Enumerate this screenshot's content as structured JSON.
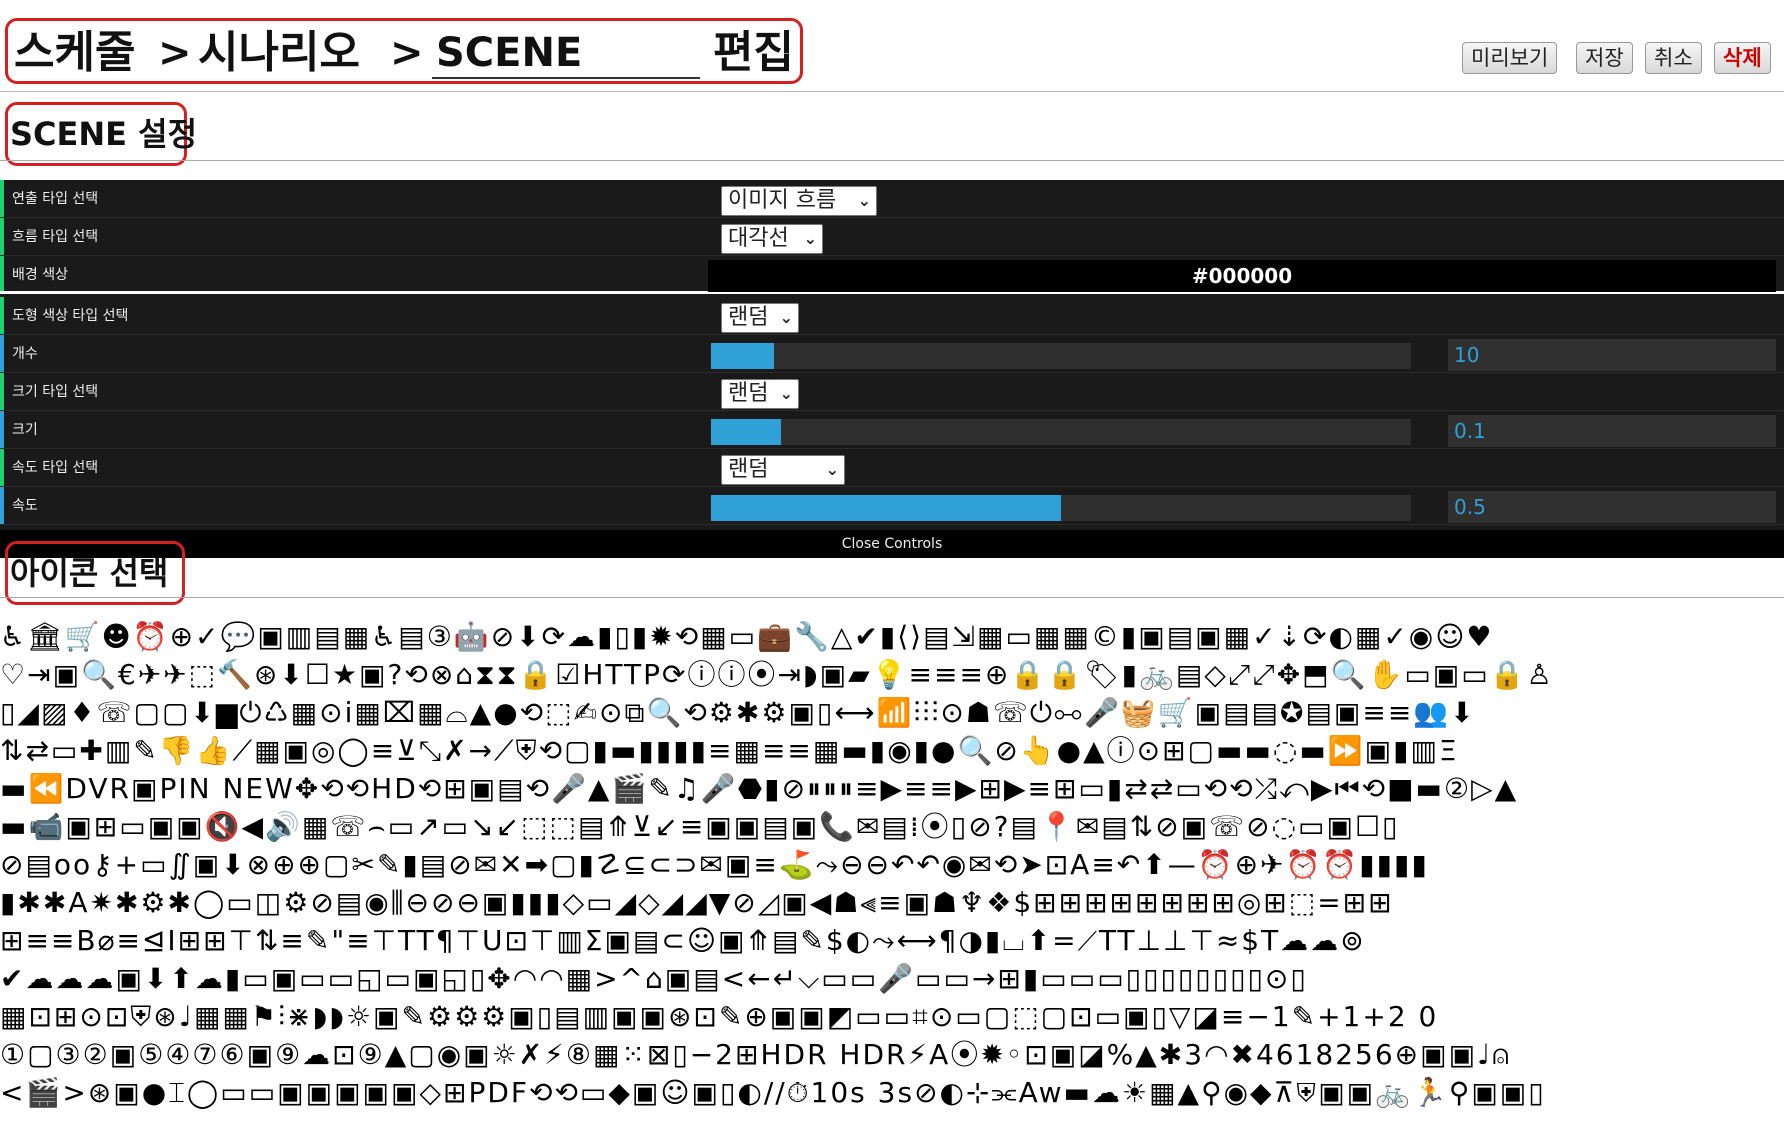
{
  "header": {
    "breadcrumb": [
      "스케줄",
      "시나리오"
    ],
    "separator": ">",
    "scene_input_value": "SCENE",
    "edit_label": "편집",
    "buttons": {
      "preview": "미리보기",
      "save": "저장",
      "cancel": "취소",
      "delete": "삭제"
    }
  },
  "scene_settings": {
    "title": "SCENE 설정",
    "rows": [
      {
        "label": "연출 타입 선택",
        "type": "select",
        "value": "이미지 흐름",
        "accent": "#1ed36f"
      },
      {
        "label": "흐름 타입 선택",
        "type": "select",
        "value": "대각선",
        "accent": "#1ed36f"
      },
      {
        "label": "배경 색상",
        "type": "color",
        "value": "#000000",
        "accent": "#1ed36f"
      },
      {
        "label": "도형 색상 타입 선택",
        "type": "select",
        "value": "랜덤",
        "accent": "#1ed36f"
      },
      {
        "label": "개수",
        "type": "slider",
        "value": "10",
        "fill": 0.09,
        "accent": "#2fa1d6"
      },
      {
        "label": "크기 타입 선택",
        "type": "select",
        "value": "랜덤",
        "accent": "#1ed36f"
      },
      {
        "label": "크기",
        "type": "slider",
        "value": "0.1",
        "fill": 0.1,
        "accent": "#2fa1d6"
      },
      {
        "label": "속도 타입 선택",
        "type": "select",
        "value": "랜덤",
        "accent": "#1ed36f"
      },
      {
        "label": "속도",
        "type": "slider",
        "value": "0.5",
        "fill": 0.5,
        "accent": "#2fa1d6"
      }
    ],
    "close_label": "Close Controls"
  },
  "icon_select": {
    "title": "아이콘 선택",
    "rows": [
      "♿🏛🛒☻⏰⊕✓💬▣▥▤▦♿▤③🤖⊘⬇⟳☁▮▯▮✹⟲▦▭💼🔧△✔▮⟨⟩▤⇲▦▭▦▦©▮▣▤▣▦✓⇣⟳◐▦✓◉☺♥",
      "♡⇥▣🔍€✈✈⬚🔨⊛⬇☐★▣?⟲⊗⌂⧗⧗🔒☑HTTP⟳ⓘⓘ⦿⇥◗▣▰💡≡≡≡⊕🔒🔒🏷▮🚲▤◇⤢⤢✥⬒🔍✋▭▣▭🔒♙",
      "▯◢▨♦☏▢▢⬇▆⏻♺▦⊙ⅰ▦⌧▦⌓▲●⟲⬚✍⊙⧉🔍⟲⚙✱⚙▣▯⟷📶⫶⫶⫶⊙☗☏⏻⧟🎤🧺🛒▣▤▤✪▤▣≡≡👥⬇",
      "⇅⇄▭✚▥✎👎👍⟋▦▣◎◯≡⊻⤡✗→⟋⛨⟲▢▮▬▮▮▮▮≡▦≡≡▦▬▮◉▮●🔍⊘👆●▲ⓘ⊙⊞▢▬▬◌▬⏩▣▮▥Ξ",
      "▬⏪DVR▣PIN NEW✥⟲⟲HD⟲⊞▣▤⟲🎤▲🎬✎♫🎤⬣▮⊘⏸⏸⏸≡▶≡≡▶⊞▶≡⊞▭▮⇄⇄▭⟲⟲⤮⤺▶⏮⟲■▬②▷▲",
      "▬📹▣⊞▭▣▣🔇◀🔊▦☏⌢▭↗▭↘↙⬚⬚▤⤊⊻↙≡▣▣▤▣📞✉▤⁞⦿▯⊘?▤📍✉▤⇅⊘▣☏⊘◌▭▣☐▯",
      "⊘▤oo⚷+▭∬▣⬇⊗⊕⊕▢✂✎▮▤⊘✉✕➡▢▮☡⊆⊂⊃✉▣≡⛳⤳⊖⊖↶↶◉✉⟲➤⊡A≡↶⬆—⏰⊕✈⏰⏰▮▮▮▮",
      "▮✱✱A✷✱⚙✱◯▭◫⚙⊘▤◉⫼⊖⊘⊖▣▮▮▮◇▭◢◇◢◢▼⊘◿▣◀☗⫷≡▣☗♆❖$⊞⊞⊞⊞⊞⊞⊞⊞◎⊞⬚=⊞⊞",
      "⊞≡≡B⌀≡⊴I⊞⊞⊤⇅≡✎\"≡⊤TT¶⊤U⊡⊤▥Σ▣▤⊂☺▣⤊▤✎$◐⤳⟷¶◑▮⌴⬆=⟋TT⊥⊥⊤≈$T☁☁⊚",
      "✔☁☁☁▣⬇⬆☁▮▭▣▭▭◱▭▣◱▯✥◠◠▦>^⌂▣▤<←↵⌵▭▭🎤▭▭→⊞▮▭▭▭▯▯▯▯▯▯▯▯⊙▯",
      "▦⊡⊞⊙⊡⛨⊛♩▦▦⚑⫶⋇◗◗☼▣✎⚙⚙⚙▣▯▤▥▣▣⊛⊡✎⊕▣▣◩▭▭⌗⊙▭▢⬚▢⊡▭▣▯▽◪≡−1✎+1+2 0",
      "①▢③②▣⑤④⑦⑥▣⑨☁⊡⑨▲▢◉▣☼✗⚡⑧▦⁙⊠▯−2⊞HDR HDR⚡A⦿✹◦⊡▣◪%▲✱3◠✖4618256⊕▣▣♩⍝",
      "<🎬>⊛▣●⌶◯▭▭▣▣▣▣▣◇⊞PDF⟲⟲▭◆▣☺▣▯◐//⏱10s 3s⊘◐⊹⫘Aw▬☁☀▦▲⚲◉◆⊼⛨▣▣🚲🏃⚲▣▣▯"
    ]
  }
}
